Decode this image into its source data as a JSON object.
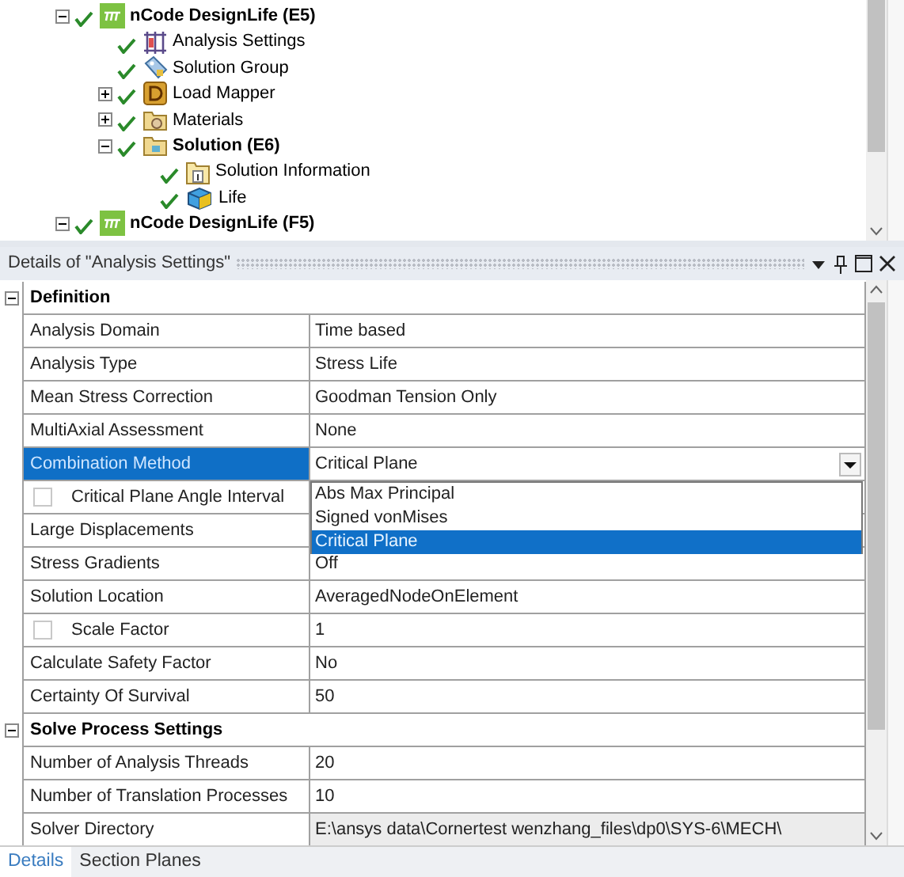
{
  "tree": {
    "items": [
      {
        "label": "nCode DesignLife (E5)",
        "kind": "system",
        "bold": true,
        "checked": true,
        "expanded": true,
        "children": [
          {
            "label": "Analysis Settings",
            "kind": "settings",
            "bold": false,
            "checked": true
          },
          {
            "label": "Solution Group",
            "kind": "group",
            "bold": false,
            "checked": true
          },
          {
            "label": "Load Mapper",
            "kind": "mapper",
            "bold": false,
            "checked": true,
            "expanded": false
          },
          {
            "label": "Materials",
            "kind": "folder",
            "bold": false,
            "checked": true,
            "expanded": false
          },
          {
            "label": "Solution (E6)",
            "kind": "solution",
            "bold": true,
            "checked": true,
            "expanded": true,
            "children": [
              {
                "label": "Solution Information",
                "kind": "info",
                "bold": false,
                "checked": true
              },
              {
                "label": "Life",
                "kind": "result",
                "bold": false,
                "checked": true
              }
            ]
          }
        ]
      },
      {
        "label": "nCode DesignLife (F5)",
        "kind": "system",
        "bold": true,
        "checked": true,
        "expanded": true
      }
    ]
  },
  "details": {
    "title": "Details of \"Analysis Settings\"",
    "rows": [
      {
        "kind": "section",
        "label": "Definition",
        "expanded": true
      },
      {
        "kind": "property",
        "label": "Analysis Domain",
        "value": "Time based",
        "selected": false
      },
      {
        "kind": "property",
        "label": "Analysis Type",
        "value": "Stress Life",
        "selected": false
      },
      {
        "kind": "property",
        "label": "Mean Stress Correction",
        "value": "Goodman Tension Only",
        "selected": false
      },
      {
        "kind": "property",
        "label": "MultiAxial Assessment",
        "value": "None",
        "selected": false
      },
      {
        "kind": "dropdown",
        "label": "Combination Method",
        "value": "Critical Plane",
        "selected": true,
        "expanded": true,
        "options": [
          {
            "label": "Abs Max Principal",
            "selected": false
          },
          {
            "label": "Signed vonMises",
            "selected": false
          },
          {
            "label": "Critical Plane",
            "selected": true
          }
        ]
      },
      {
        "kind": "checkbox",
        "label": "Critical Plane Angle Interval",
        "checked": false,
        "selected": false
      },
      {
        "kind": "property",
        "label": "Large Displacements",
        "selected": false
      },
      {
        "kind": "property",
        "label": "Stress Gradients",
        "value": "Off",
        "selected": false
      },
      {
        "kind": "property",
        "label": "Solution Location",
        "value": "AveragedNodeOnElement",
        "selected": false
      },
      {
        "kind": "checkbox",
        "label": "Scale Factor",
        "value": "1",
        "checked": false,
        "selected": false
      },
      {
        "kind": "property",
        "label": "Calculate Safety Factor",
        "value": "No",
        "selected": false
      },
      {
        "kind": "property",
        "label": "Certainty Of Survival",
        "value": "50",
        "selected": false
      },
      {
        "kind": "section",
        "label": "Solve Process Settings",
        "expanded": true
      },
      {
        "kind": "property",
        "label": "Number of Analysis Threads",
        "value": "20",
        "selected": false
      },
      {
        "kind": "property",
        "label": "Number of Translation Processes",
        "value": "10",
        "selected": false
      },
      {
        "kind": "property",
        "label": "Solver Directory",
        "value": "E:\\ansys data\\Cornertest wenzhang_files\\dp0\\SYS-6\\MECH\\",
        "selected": false,
        "disabled": true
      }
    ]
  },
  "tabs": [
    {
      "label": "Details",
      "selected": true
    },
    {
      "label": "Section Planes",
      "selected": false
    }
  ]
}
